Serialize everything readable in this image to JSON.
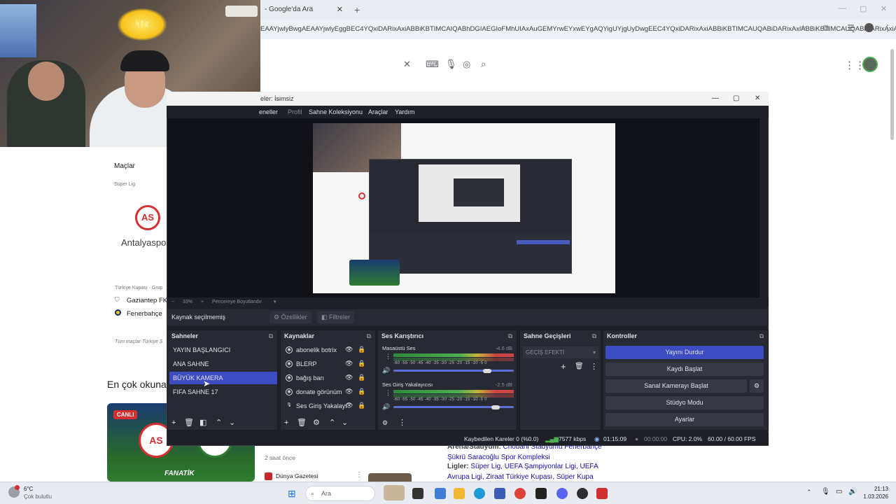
{
  "browser": {
    "tab_title": "- Google'da Ara",
    "tab_close": "✕",
    "new_tab": "+",
    "url": "EAAYjwlyBwgAEAAYjwlyEggBEC4YQxiDARixAxiABBiKBTIMCAIQABhDGIAEGIoFMhUIAxAuGEMYrwEYxwEYgAQYigUYjgUyDwgEEC4YQxiDARixAxiABBiKBTIMCAUQABiDARixAxiABBiKBTIMCAUQABiDARixAxiABBDINCAYQABiD..."
  },
  "google": {
    "matches_title": "Maçlar",
    "league": "Süper Lig",
    "team": "Antalyaspo",
    "team_logo": "AS",
    "cup": "Türkiye Kupası · Grup",
    "team_a": "Gaziantep FK",
    "team_b": "Fenerbahçe",
    "all_matches": "Tüm maçlar Türkiye S",
    "most_read": "En çok okuna",
    "live_badge": "CANLI",
    "news_brand": "FANATİK",
    "time_ago": "2 saat önce",
    "source": "Dünya Gazetesi",
    "arena_label": "Arena/Stadyum:",
    "arena_value": "Chobani Stadyumu Fenerbahçe Şükrü Saracoğlu Spor Kompleksi",
    "leagues_label": "Ligler:",
    "leagues_value": "Süper Lig, UEFA Şampiyonlar Ligi, UEFA Avrupa Ligi, Ziraat Türkiye Kupası, Süper Kupa"
  },
  "webcam": {
    "neon_text": "ᛋᛏᛟ"
  },
  "obs": {
    "title": "eler: İsimsiz",
    "menu": [
      "eneller",
      "Profil",
      "Sahne Koleksiyonu",
      "Araçlar",
      "Yardım"
    ],
    "zoom": "33%",
    "fit_mode": "Pencereye Boyutlandır",
    "no_source": "Kaynak seçilmemiş",
    "properties_btn": "Özellikler",
    "filters_btn": "Filtreler",
    "scenes_title": "Sahneler",
    "scenes": [
      "YAYIN BAŞLANGICI",
      "ANA SAHNE",
      "BÜYÜK KAMERA",
      "FIFA SAHNE 17"
    ],
    "selected_scene": "BÜYÜK KAMERA",
    "sources_title": "Kaynaklar",
    "sources": [
      "abonelik botrix",
      "BLERP",
      "bağış barı",
      "donate görünüm",
      "Ses Giriş Yakalayı"
    ],
    "mixer_title": "Ses Karıştırıcı",
    "mixer": [
      {
        "name": "Masaüstü Ses",
        "db": "-4.6 dB",
        "level": 0.78
      },
      {
        "name": "Ses Giriş Yakalayıcısı",
        "db": "-2.5 dB",
        "level": 0.85
      }
    ],
    "mixer_scale": "-60 -55 -50 -45 -40 -35 -30 -25 -20 -15 -10 -5 0",
    "transitions_title": "Sahne Geçişleri",
    "transition_select": "GEÇİŞ EFEKTİ",
    "controls_title": "Kontroller",
    "controls": [
      "Yayını Durdur",
      "Kaydı Başlat",
      "Sanal Kamerayı Başlat",
      "Stüdyo Modu",
      "Ayarlar"
    ],
    "status": {
      "dropped": "Kaybedilen Kareler 0 (%0.0)",
      "bitrate": "7577 kbps",
      "live_time": "01:15:09",
      "rec_time": "00:00:00",
      "cpu": "CPU: 2.0%",
      "fps": "60.00 / 60.00 FPS"
    }
  },
  "taskbar": {
    "weather_temp": "6°C",
    "weather_desc": "Çok bulutlu",
    "search_placeholder": "Ara",
    "clock_time": "21:13",
    "clock_date": "1.03.2026"
  }
}
